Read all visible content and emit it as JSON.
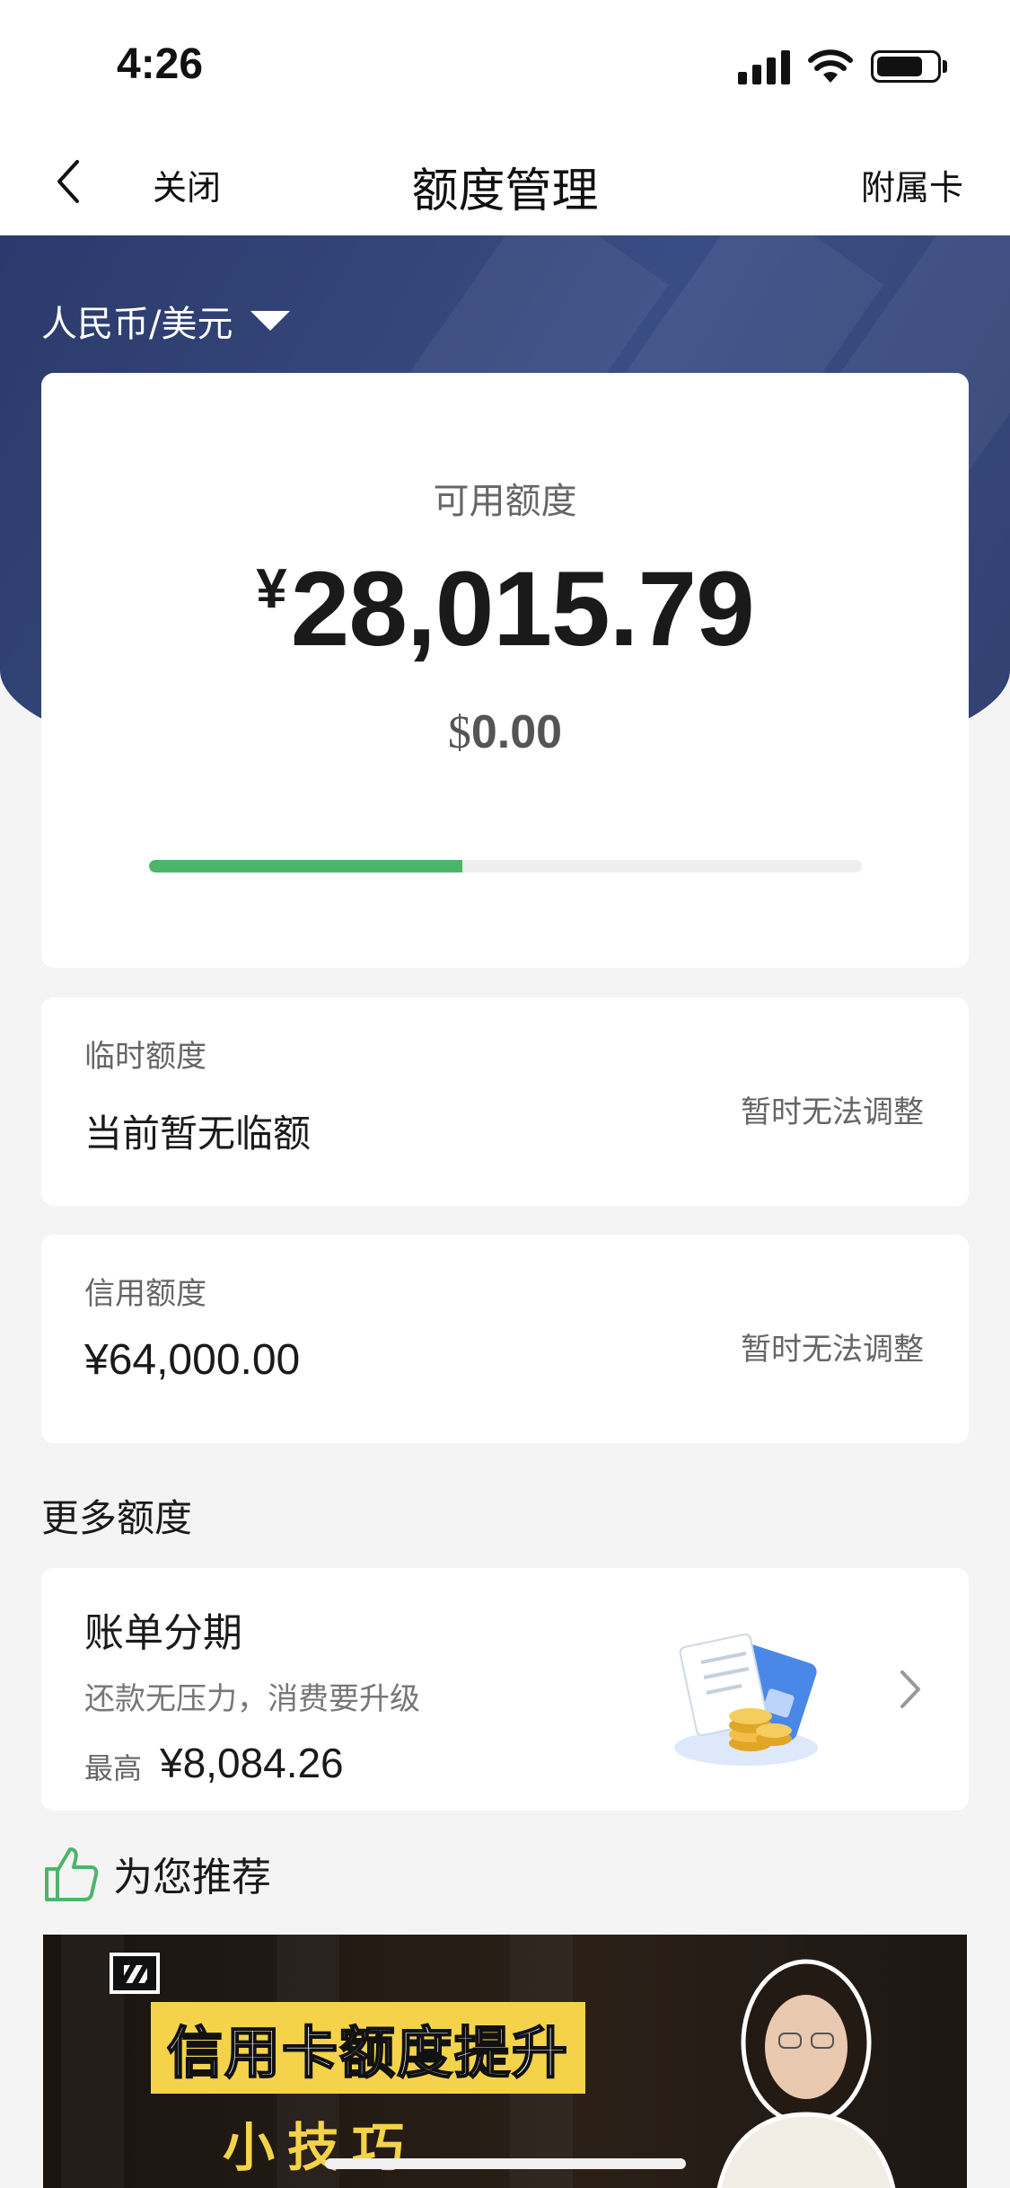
{
  "status_bar": {
    "time": "4:26"
  },
  "nav": {
    "close_label": "关闭",
    "title": "额度管理",
    "sub_card_label": "附属卡"
  },
  "currency_switch": {
    "label": "人民币/美元"
  },
  "available": {
    "label": "可用额度",
    "cny_symbol": "¥",
    "cny_value": "28,015.79",
    "usd_symbol": "$",
    "usd_value": "0.00",
    "progress_fraction": 0.44
  },
  "temporary_limit": {
    "label": "临时额度",
    "value": "当前暂无临额",
    "status": "暂时无法调整"
  },
  "credit_limit": {
    "label": "信用额度",
    "value": "¥64,000.00",
    "status": "暂时无法调整"
  },
  "more": {
    "title": "更多额度",
    "installment": {
      "title": "账单分期",
      "subtitle": "还款无压力，消费要升级",
      "max_label": "最高",
      "max_value": "¥8,084.26"
    }
  },
  "recommend": {
    "title": "为您推荐",
    "video": {
      "title": "信用卡额度提升",
      "subtitle": "小技巧"
    }
  },
  "colors": {
    "hero": "#34467a",
    "progress": "#4cb56b",
    "accent_green": "#4cb56b",
    "banner_yellow": "#f4d34a"
  }
}
